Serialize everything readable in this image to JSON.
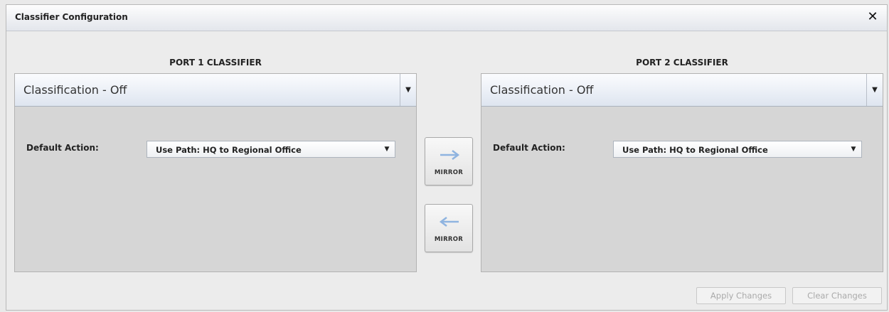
{
  "window": {
    "title": "Classifier Configuration"
  },
  "port1": {
    "heading": "PORT 1 CLASSIFIER",
    "classification": "Classification - Off",
    "default_action_label": "Default Action:",
    "default_action_value": "Use Path: HQ to Regional Office"
  },
  "port2": {
    "heading": "PORT 2 CLASSIFIER",
    "classification": "Classification - Off",
    "default_action_label": "Default Action:",
    "default_action_value": "Use Path: HQ to Regional Office"
  },
  "mirror": {
    "to_port2_label": "MIRROR",
    "to_port1_label": "MIRROR"
  },
  "footer": {
    "apply": "Apply Changes",
    "clear": "Clear Changes"
  },
  "icons": {
    "close": "close-icon",
    "arrow_right": "arrow-right-icon",
    "arrow_left": "arrow-left-icon",
    "dropdown": "chevron-down-icon"
  },
  "colors": {
    "arrow": "#8fb4e0",
    "disabled_text": "#aaaaaa"
  }
}
